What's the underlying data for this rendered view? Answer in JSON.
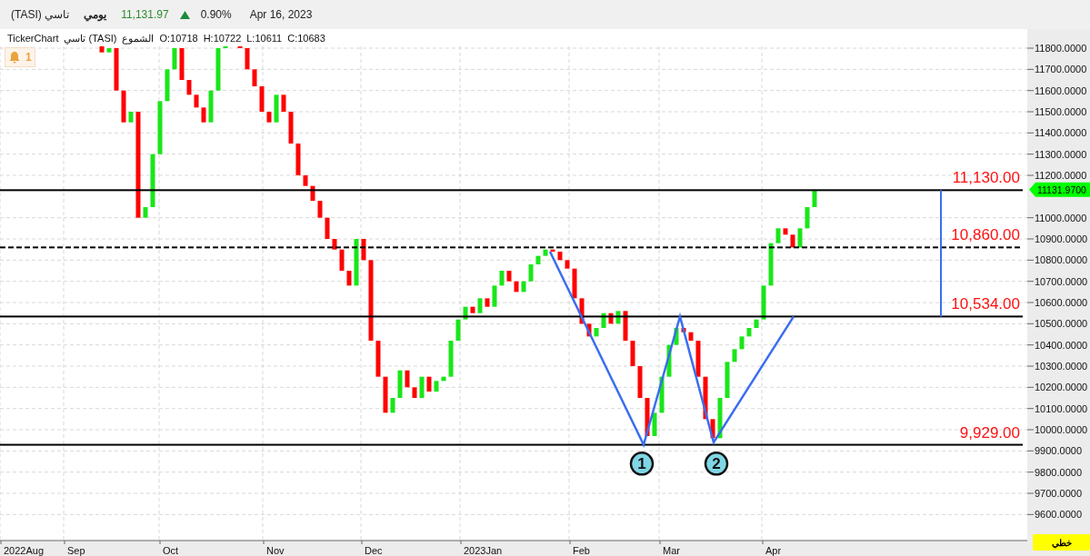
{
  "header": {
    "symbol": "تاسي (TASI)",
    "period": "يومي",
    "price": "11,131.97",
    "change": "0.90%",
    "date": "Apr 16, 2023"
  },
  "info_line": {
    "source": "TickerChart",
    "symbol": "تاسي (TASI)",
    "chart_type": "الشموع",
    "open": "O:10718",
    "high": "H:10722",
    "low": "L:10611",
    "close": "C:10683"
  },
  "alerts": {
    "count": "1"
  },
  "chart_type_button": {
    "label": "خطي"
  },
  "chart": {
    "price_axis": [
      "11800.0000",
      "11700.0000",
      "11600.0000",
      "11500.0000",
      "11400.0000",
      "11300.0000",
      "11200.0000",
      "11000.0000",
      "10900.0000",
      "10800.0000",
      "10700.0000",
      "10600.0000",
      "10500.0000",
      "10400.0000",
      "10300.0000",
      "10200.0000",
      "10100.0000",
      "10000.0000",
      "9900.0000",
      "9800.0000",
      "9700.0000",
      "9600.0000"
    ],
    "time_axis": [
      "2022Aug",
      "Sep",
      "Oct",
      "Nov",
      "Dec",
      "2023Jan",
      "Feb",
      "Mar",
      "Apr"
    ],
    "levels": [
      {
        "label": "11,130.00",
        "dashed": false
      },
      {
        "label": "10,860.00",
        "dashed": true
      },
      {
        "label": "10,534.00",
        "dashed": false
      },
      {
        "label": "9,929.00",
        "dashed": false
      }
    ],
    "pattern_markers": [
      "1",
      "2"
    ],
    "price_tag": "11131.9700"
  }
}
